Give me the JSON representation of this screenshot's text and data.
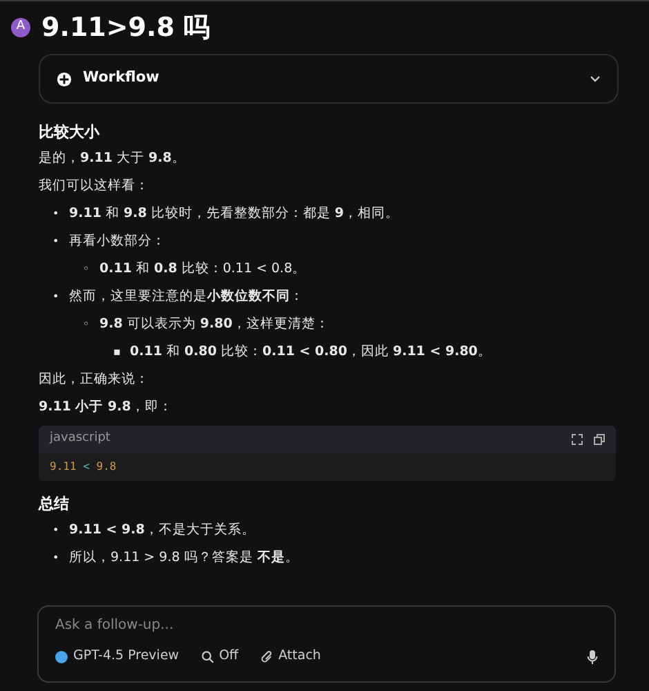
{
  "header": {
    "avatar": "A",
    "title": "9.11>9.8 吗"
  },
  "workflow": {
    "label": "Workflow",
    "expanded": false
  },
  "answer": [
    {
      "kind": "heading",
      "text": "比较大小"
    },
    {
      "kind": "paragraph",
      "text": "是的，**9.11** 大于 **9.8**。"
    },
    {
      "kind": "paragraph",
      "text": "我们可以这样看："
    },
    {
      "kind": "list",
      "items": [
        {
          "marker": "•",
          "text": "**9.11** 和 **9.8** 比较时，先看整数部分：都是 **9**，相同。"
        },
        {
          "marker": "•",
          "text": "再看小数部分：",
          "children": [
            {
              "marker": "◦",
              "text": "**0.11** 和 **0.8** 比较：0.11 < 0.8。"
            }
          ]
        },
        {
          "marker": "•",
          "text": "然而，这里要注意的是**小数位数不同**：",
          "children": [
            {
              "marker": "◦",
              "text": "**9.8** 可以表示为 **9.80**，这样更清楚：",
              "children": [
                {
                  "marker": "▪",
                  "text": "**0.11** 和 **0.80** 比较：**0.11 < 0.80**，因此 **9.11 < 9.80**。"
                }
              ]
            }
          ]
        }
      ]
    },
    {
      "kind": "paragraph",
      "text": "因此，正确来说："
    },
    {
      "kind": "paragraph",
      "text": "**9.11 小于 9.8**，即："
    },
    {
      "kind": "code",
      "language": "javascript",
      "tokens": [
        {
          "text": "9.11",
          "kind": "number"
        },
        {
          "text": "<",
          "kind": "operator"
        },
        {
          "text": "9.8",
          "kind": "number"
        }
      ]
    },
    {
      "kind": "heading",
      "text": "总结"
    },
    {
      "kind": "list",
      "items": [
        {
          "marker": "•",
          "text": "**9.11 < 9.8**，不是大于关系。"
        },
        {
          "marker": "•",
          "text": "所以，9.11 > 9.8 吗？答案是 **不是**。"
        }
      ]
    }
  ],
  "composer": {
    "placeholder": "Ask a follow-up...",
    "model": "GPT-4.5 Preview",
    "search": "Off",
    "attach": "Attach"
  }
}
